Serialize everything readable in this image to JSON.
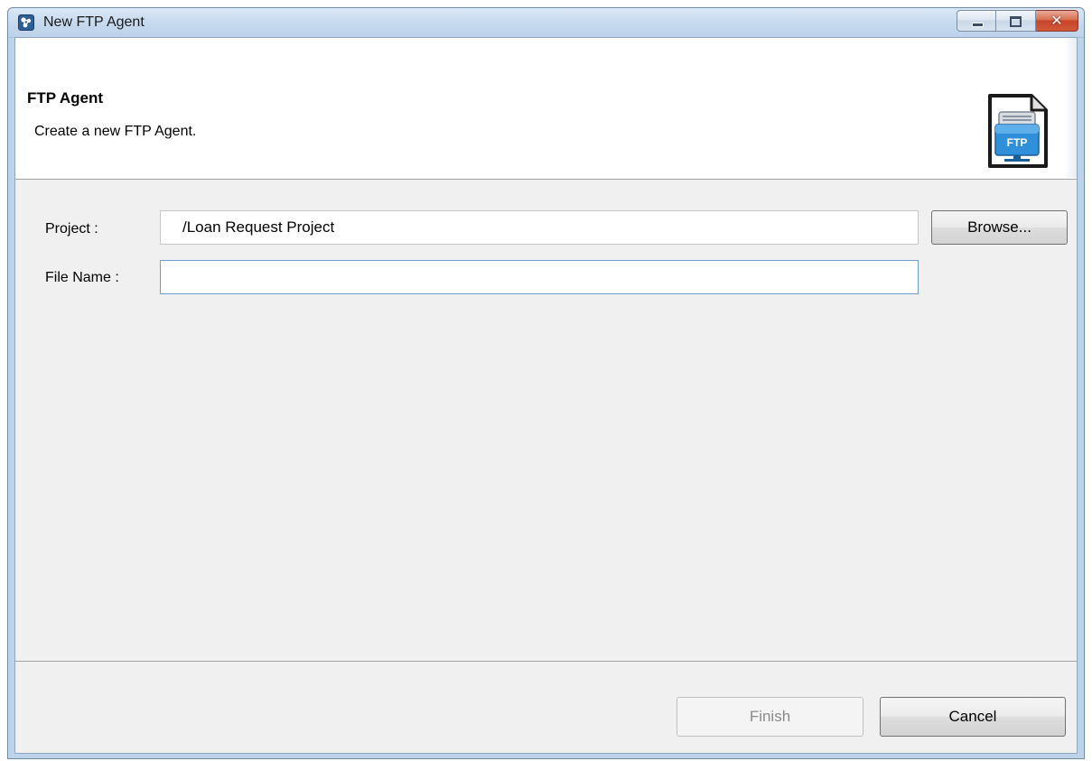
{
  "window": {
    "title": "New FTP Agent",
    "app_icon": "app-logo-icon",
    "controls": {
      "minimize": "minimize-icon",
      "maximize": "maximize-icon",
      "close": "close-icon",
      "close_glyph": "✕"
    }
  },
  "banner": {
    "title": "FTP Agent",
    "description": "Create a new FTP Agent.",
    "icon": "ftp-folder-icon",
    "icon_text": "FTP"
  },
  "form": {
    "project": {
      "label": "Project :",
      "value": "/Loan Request Project"
    },
    "file_name": {
      "label": "File Name :",
      "value": "",
      "placeholder": ""
    },
    "browse_label": "Browse..."
  },
  "footer": {
    "finish_label": "Finish",
    "finish_enabled": false,
    "cancel_label": "Cancel"
  },
  "colors": {
    "title_bar": "#c7daee",
    "close_button": "#c7442a",
    "dialog_background": "#f0f0f0",
    "field_focus_border": "#6f9dd2"
  }
}
